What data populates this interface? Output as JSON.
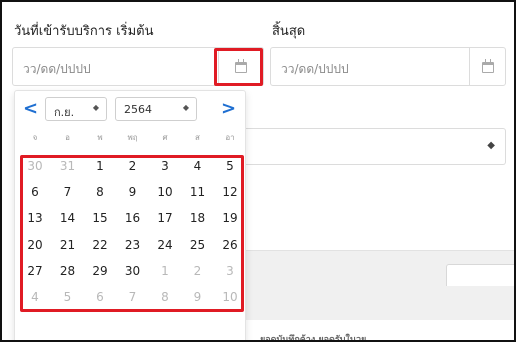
{
  "form": {
    "start_label": "วันที่เข้ารับบริการ เริ่มต้น",
    "end_label": "สิ้นสุด",
    "start_placeholder": "วว/ดด/ปปปป",
    "end_placeholder": "วว/ดด/ปปปป",
    "calendar_icon": "calendar-icon",
    "select_caret": "◆"
  },
  "picker": {
    "prev": "<",
    "next": ">",
    "month": "ก.ย.",
    "year": "2564",
    "select_arrow": "◆",
    "weekdays": [
      "จ",
      "อ",
      "พ",
      "พฤ",
      "ศ",
      "ส",
      "อา"
    ],
    "weeks": [
      [
        "30",
        "31",
        "1",
        "2",
        "3",
        "4",
        "5"
      ],
      [
        "6",
        "7",
        "8",
        "9",
        "10",
        "11",
        "12"
      ],
      [
        "13",
        "14",
        "15",
        "16",
        "17",
        "18",
        "19"
      ],
      [
        "20",
        "21",
        "22",
        "23",
        "24",
        "25",
        "26"
      ],
      [
        "27",
        "28",
        "29",
        "30",
        "1",
        "2",
        "3"
      ],
      [
        "4",
        "5",
        "6",
        "7",
        "8",
        "9",
        "10"
      ]
    ],
    "muted": [
      [
        true,
        true,
        false,
        false,
        false,
        false,
        false
      ],
      [
        false,
        false,
        false,
        false,
        false,
        false,
        false
      ],
      [
        false,
        false,
        false,
        false,
        false,
        false,
        false
      ],
      [
        false,
        false,
        false,
        false,
        false,
        false,
        false
      ],
      [
        false,
        false,
        false,
        false,
        true,
        true,
        true
      ],
      [
        true,
        true,
        true,
        true,
        true,
        true,
        true
      ]
    ]
  },
  "background": {
    "footer_text": "ยอดบันทึกค้าง ยอดรับในวย"
  },
  "colors": {
    "accent": "#1f6fd1",
    "annotation": "#e01b24"
  }
}
